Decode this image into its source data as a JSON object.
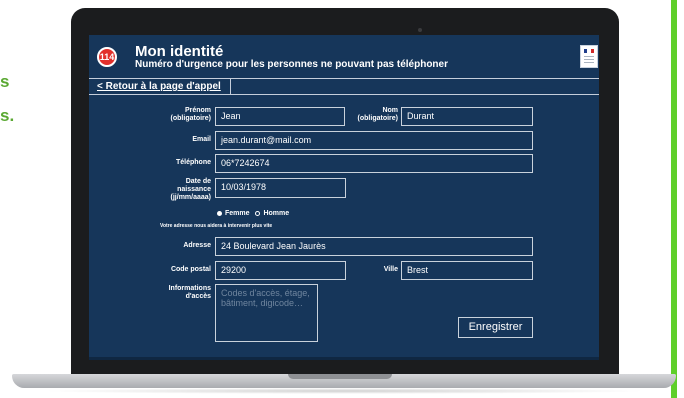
{
  "edge_text": [
    "s",
    "s."
  ],
  "colors": {
    "accent_green": "#5fcf2a",
    "screen_bg": "#16365a",
    "logo_red": "#e2302b"
  },
  "header": {
    "logo": "114",
    "title": "Mon identité",
    "subtitle": "Numéro d'urgence pour les personnes ne pouvant pas téléphoner",
    "emblem_icon": "marianne-flag-icon"
  },
  "nav": {
    "back_link": "< Retour à la page d'appel"
  },
  "form": {
    "prenom": {
      "label": "Prénom",
      "note": "(obligatoire)",
      "value": "Jean"
    },
    "nom": {
      "label": "Nom",
      "note": "(obligatoire)",
      "value": "Durant"
    },
    "email": {
      "label": "Email",
      "value": "jean.durant@mail.com"
    },
    "telephone": {
      "label": "Téléphone",
      "value": "06*7242674"
    },
    "naissance": {
      "label_lines": [
        "Date de",
        "naissance",
        "(jj/mm/aaaa)"
      ],
      "value": "10/03/1978"
    },
    "gender": {
      "options": [
        "Femme",
        "Homme"
      ],
      "selected": "Femme"
    },
    "address_help": "Votre adresse nous aidera à intervenir plus vite",
    "adresse": {
      "label": "Adresse",
      "value": "24 Boulevard Jean Jaurès"
    },
    "code_postal": {
      "label": "Code postal",
      "value": "29200"
    },
    "ville": {
      "label": "Ville",
      "value": "Brest"
    },
    "acces": {
      "label_lines": [
        "Informations",
        "d'accès"
      ],
      "placeholder": "Codes d'accès, étage, bâtiment, digicode…"
    },
    "submit": "Enregistrer"
  }
}
